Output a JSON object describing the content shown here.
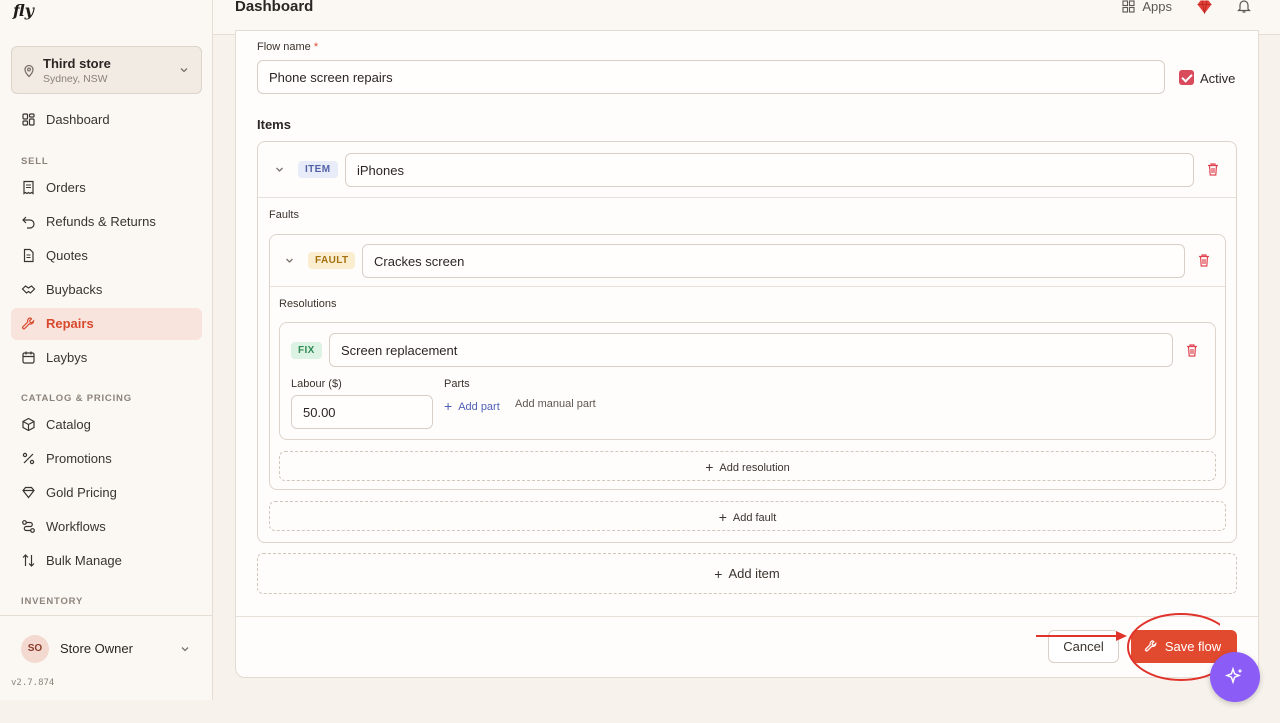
{
  "app": {
    "logo": "fly",
    "version": "v2.7.874"
  },
  "header": {
    "title": "Dashboard",
    "apps_label": "Apps"
  },
  "store": {
    "name": "Third store",
    "location": "Sydney, NSW"
  },
  "sidebar": {
    "dashboard": "Dashboard",
    "sections": {
      "sell": "SELL",
      "catalog": "CATALOG & PRICING",
      "inventory": "INVENTORY"
    },
    "items": [
      {
        "label": "Orders"
      },
      {
        "label": "Refunds & Returns"
      },
      {
        "label": "Quotes"
      },
      {
        "label": "Buybacks"
      },
      {
        "label": "Repairs"
      },
      {
        "label": "Laybys"
      },
      {
        "label": "Catalog"
      },
      {
        "label": "Promotions"
      },
      {
        "label": "Gold Pricing"
      },
      {
        "label": "Workflows"
      },
      {
        "label": "Bulk Manage"
      }
    ],
    "active": "Repairs"
  },
  "user": {
    "initials": "SO",
    "name": "Store Owner"
  },
  "form": {
    "flow_name_label": "Flow name",
    "required_mark": "*",
    "flow_name_value": "Phone screen repairs",
    "active_label": "Active",
    "active_checked": true,
    "items_heading": "Items",
    "item_badge": "ITEM",
    "item_value": "iPhones",
    "faults_label": "Faults",
    "fault_badge": "FAULT",
    "fault_value": "Crackes screen",
    "resolutions_label": "Resolutions",
    "fix_badge": "FIX",
    "fix_value": "Screen replacement",
    "labour_label": "Labour ($)",
    "labour_value": "50.00",
    "parts_label": "Parts",
    "add_part": "Add part",
    "add_manual_part": "Add manual part",
    "add_resolution": "Add resolution",
    "add_fault": "Add fault",
    "add_item": "Add item"
  },
  "actions": {
    "cancel": "Cancel",
    "save": "Save flow"
  },
  "colors": {
    "accent": "#e24a2f",
    "annotation": "#e0332b",
    "fab": "#8b5cf6"
  }
}
